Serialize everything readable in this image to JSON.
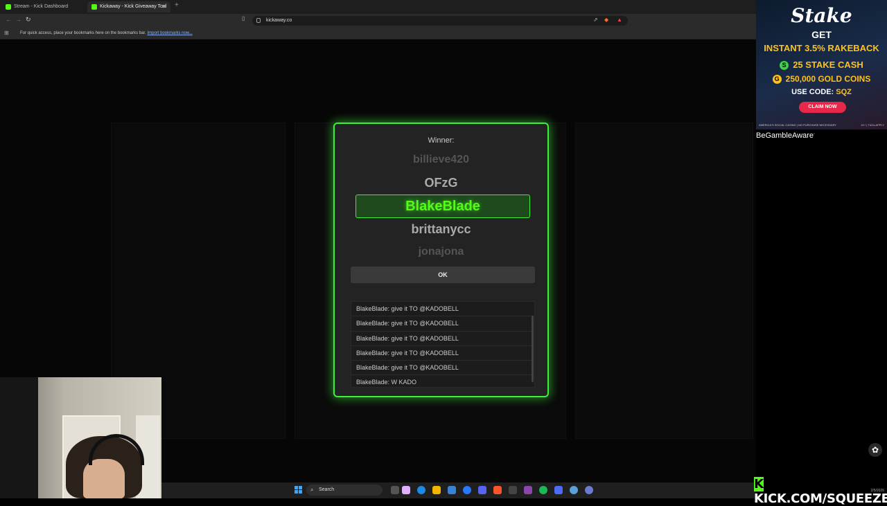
{
  "browser": {
    "tabs": [
      {
        "label": "Stream - Kick Dashboard",
        "active": false
      },
      {
        "label": "Kickaway - Kick Giveaway Tool",
        "active": true
      }
    ],
    "url": "kickaway.co",
    "bookmarks_message": "For quick access, place your bookmarks here on the bookmarks bar.",
    "bookmarks_link": "Import bookmarks now..."
  },
  "modal": {
    "winner_label": "Winner:",
    "reel": {
      "above_far": "billieve420",
      "above_near": "OFzG",
      "selected": "BlakeBlade",
      "below_near": "brittanycc",
      "below_far": "jonajona"
    },
    "ok_label": "OK",
    "chat": [
      "BlakeBlade: give it TO @KADOBELL",
      "BlakeBlade: give it TO @KADOBELL",
      "BlakeBlade: give it TO @KADOBELL",
      "BlakeBlade: give it TO @KADOBELL",
      "BlakeBlade: give it TO @KADOBELL",
      "BlakeBlade: W KADO"
    ]
  },
  "ad": {
    "brand": "Stake",
    "get": "GET",
    "line1": "INSTANT 3.5% RAKEBACK",
    "line2": "25 STAKE CASH",
    "line3": "250,000 GOLD COINS",
    "code_prefix": "USE CODE: ",
    "code": "SQZ",
    "cta": "CLAIM NOW",
    "fine_left": "AMERICA'S SOCIAL CASINO | NO PURCHASE NECESSARY",
    "fine_right": "21+ | T&Cs APPLY",
    "gamble_aware": "BeGambleAware"
  },
  "taskbar": {
    "search_label": "Search"
  },
  "overlay": {
    "kick_url": "KICK.COM/SQUEEZE",
    "date": "2/5/2026"
  },
  "colors": {
    "accent_green": "#53fc18",
    "modal_border": "#3ff03a",
    "ad_gold": "#ffc21a",
    "cta_red": "#e8284a"
  }
}
